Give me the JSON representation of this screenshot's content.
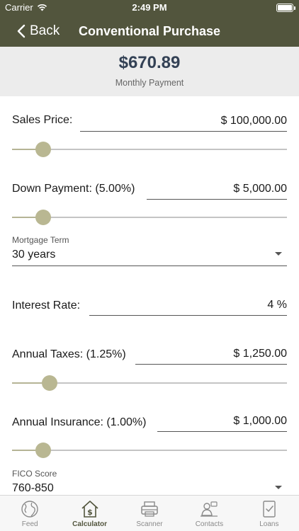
{
  "status": {
    "carrier": "Carrier",
    "time": "2:49 PM"
  },
  "nav": {
    "back_label": "Back",
    "title": "Conventional Purchase"
  },
  "summary": {
    "amount": "$670.89",
    "caption": "Monthly Payment"
  },
  "form": {
    "sales_price": {
      "label": "Sales Price:",
      "value": "$ 100,000.00",
      "slider_fraction": 0.114
    },
    "down_payment": {
      "label": "Down Payment: (5.00%)",
      "value": "$ 5,000.00",
      "slider_fraction": 0.114
    },
    "mortgage_term": {
      "label": "Mortgage Term",
      "value": "30 years"
    },
    "interest_rate": {
      "label": "Interest Rate:",
      "value": "4 %"
    },
    "annual_taxes": {
      "label": "Annual Taxes: (1.25%)",
      "value": "$ 1,250.00",
      "slider_fraction": 0.137
    },
    "annual_insurance": {
      "label": "Annual Insurance: (1.00%)",
      "value": "$ 1,000.00",
      "slider_fraction": 0.114
    },
    "fico_score": {
      "label": "FICO Score",
      "value": "760-850"
    }
  },
  "tabs": [
    {
      "label": "Feed",
      "icon": "globe-icon",
      "active": false
    },
    {
      "label": "Calculator",
      "icon": "house-dollar-icon",
      "active": true
    },
    {
      "label": "Scanner",
      "icon": "scanner-icon",
      "active": false
    },
    {
      "label": "Contacts",
      "icon": "contacts-icon",
      "active": false
    },
    {
      "label": "Loans",
      "icon": "checklist-icon",
      "active": false
    }
  ],
  "colors": {
    "header": "#52553d",
    "accent": "#b9b792",
    "amount": "#334155"
  }
}
